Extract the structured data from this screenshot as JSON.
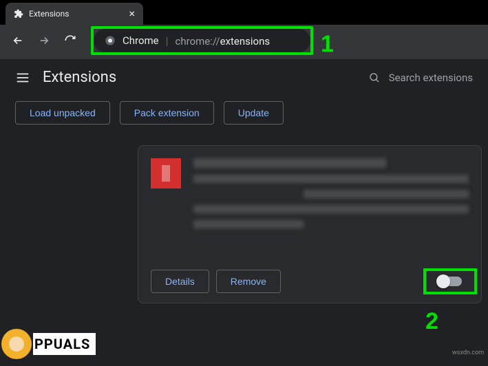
{
  "tab": {
    "title": "Extensions"
  },
  "omnibox": {
    "prefix": "Chrome",
    "scheme": "chrome://",
    "path": "extensions"
  },
  "header": {
    "title": "Extensions",
    "search_placeholder": "Search extensions"
  },
  "buttons": {
    "load_unpacked": "Load unpacked",
    "pack_extension": "Pack extension",
    "update": "Update",
    "details": "Details",
    "remove": "Remove"
  },
  "annotations": {
    "one": "1",
    "two": "2"
  },
  "watermark": "wsxdn.com",
  "logo_text": "PPUALS",
  "colors": {
    "accent": "#8ab4f8",
    "highlight": "#00e000"
  },
  "toggle": {
    "state": "off"
  }
}
